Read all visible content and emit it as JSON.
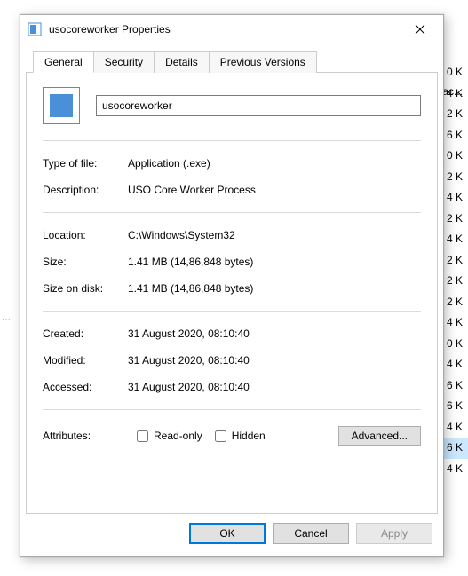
{
  "window": {
    "title": "usocoreworker Properties"
  },
  "tabs": {
    "general": "General",
    "security": "Security",
    "details": "Details",
    "previous": "Previous Versions"
  },
  "general": {
    "name_value": "usocoreworker",
    "type_label": "Type of file:",
    "type_value": "Application (.exe)",
    "desc_label": "Description:",
    "desc_value": "USO Core Worker Process",
    "location_label": "Location:",
    "location_value": "C:\\Windows\\System32",
    "size_label": "Size:",
    "size_value": "1.41 MB (14,86,848 bytes)",
    "sod_label": "Size on disk:",
    "sod_value": "1.41 MB (14,86,848 bytes)",
    "created_label": "Created:",
    "created_value": "31 August 2020, 08:10:40",
    "modified_label": "Modified:",
    "modified_value": "31 August 2020, 08:10:40",
    "accessed_label": "Accessed:",
    "accessed_value": "31 August 2020, 08:10:40",
    "attributes_label": "Attributes:",
    "readonly_label": "Read-only",
    "hidden_label": "Hidden",
    "advanced_label": "Advanced..."
  },
  "buttons": {
    "ok": "OK",
    "cancel": "Cancel",
    "apply": "Apply"
  },
  "background": {
    "ac": "ac...",
    "rows": [
      "0 K",
      "4 K",
      "2 K",
      "6 K",
      "0 K",
      "2 K",
      "4 K",
      "2 K",
      "4 K",
      "2 K",
      "2 K",
      "2 K",
      "4 K",
      "0 K",
      "4 K",
      "6 K",
      "6 K",
      "4 K",
      "6 K",
      "4 K"
    ]
  }
}
